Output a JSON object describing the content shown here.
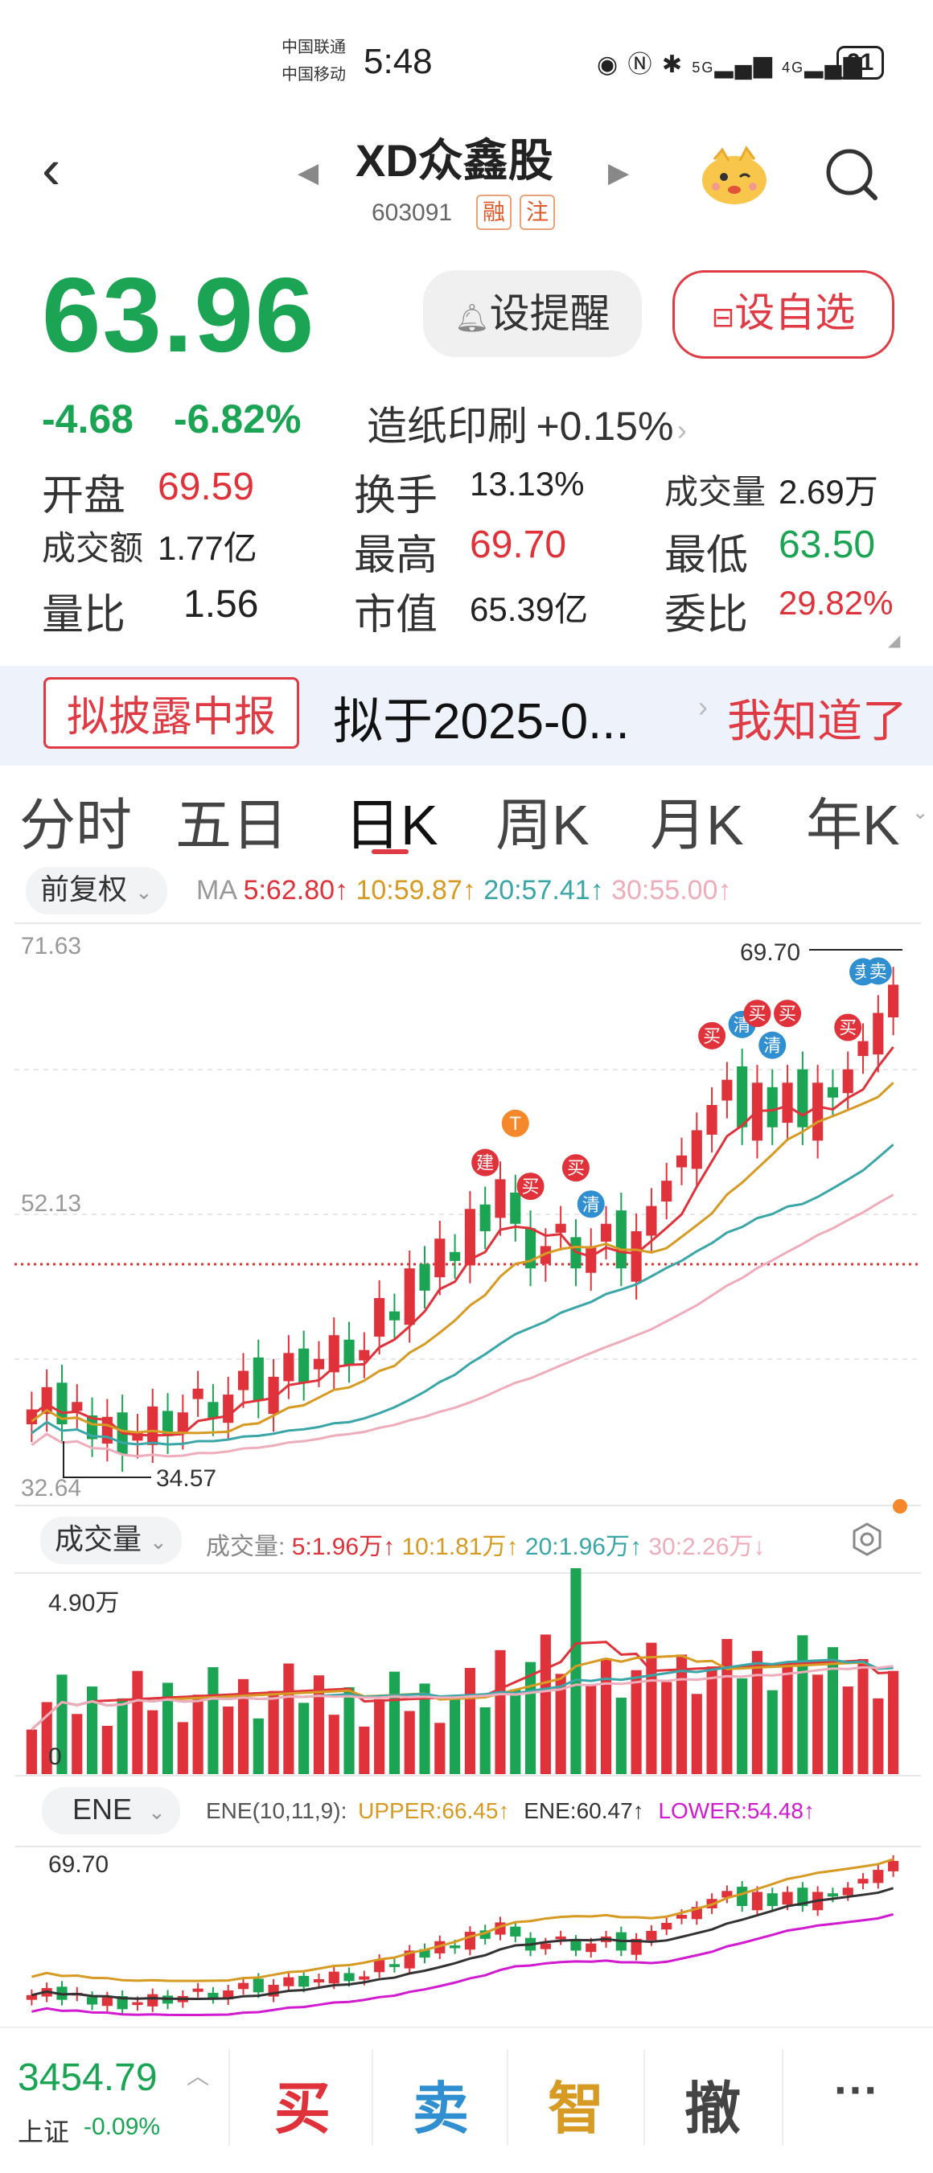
{
  "status_bar": {
    "carrier1": "中国联通",
    "carrier2": "中国移动",
    "time": "5:48",
    "network": "5G",
    "network2": "4G",
    "battery": "91"
  },
  "header": {
    "title": "XD众鑫股",
    "code": "603091",
    "badge1": "融",
    "badge2": "注"
  },
  "quote": {
    "price": "63.96",
    "remind_label": "设提醒",
    "fav_label": "设自选",
    "change": "-4.68",
    "change_pct": "-6.82%",
    "industry": "造纸印刷",
    "industry_pct": "+0.15%",
    "stats": {
      "open_label": "开盘",
      "open": "69.59",
      "turnover_label": "换手",
      "turnover": "13.13%",
      "volume_label": "成交量",
      "volume": "2.69万",
      "amount_label": "成交额",
      "amount": "1.77亿",
      "high_label": "最高",
      "high": "69.70",
      "low_label": "最低",
      "low": "63.50",
      "vratio_label": "量比",
      "vratio": "1.56",
      "mcap_label": "市值",
      "mcap": "65.39亿",
      "wb_label": "委比",
      "wb": "29.82%"
    }
  },
  "notice": {
    "tag": "拟披露中报",
    "text": "拟于2025-0...",
    "action": "我知道了"
  },
  "tabs": [
    "分时",
    "五日",
    "日K",
    "周K",
    "月K",
    "年K"
  ],
  "active_tab": 2,
  "kline": {
    "adjust": "前复权",
    "ma_label": "MA",
    "ma5": "5:62.80↑",
    "ma10": "10:59.87↑",
    "ma20": "20:57.41↑",
    "ma30": "30:55.00↑",
    "axis_top": "71.63",
    "axis_mid": "52.13",
    "axis_bottom": "32.64",
    "high_mark": "69.70",
    "low_mark": "34.57",
    "signals": [
      "建",
      "T",
      "买",
      "买",
      "清",
      "买",
      "清",
      "买",
      "清",
      "买",
      "买",
      "卖",
      "卖"
    ]
  },
  "volume": {
    "label": "成交量",
    "prefix": "成交量:",
    "v5": "5:1.96万↑",
    "v10": "10:1.81万↑",
    "v20": "20:1.96万↑",
    "v30": "30:2.26万↓",
    "axis_top": "4.90万",
    "axis_zero": "0"
  },
  "ene": {
    "label": "ENE",
    "params": "ENE(10,11,9):",
    "upper": "UPPER:66.45↑",
    "mid": "ENE:60.47↑",
    "lower": "LOWER:54.48↑",
    "axis_top": "69.70"
  },
  "bottom": {
    "index_value": "3454.79",
    "index_name": "上证",
    "index_pct": "-0.09%",
    "buy": "买",
    "sell": "卖",
    "smart": "智",
    "cancel": "撤",
    "more": "···"
  },
  "colors": {
    "up": "#e0323a",
    "down": "#1aa453",
    "ma5": "#e0323a",
    "ma10": "#d79a22",
    "ma20": "#3aa6a8",
    "ma30": "#efadbb"
  }
}
